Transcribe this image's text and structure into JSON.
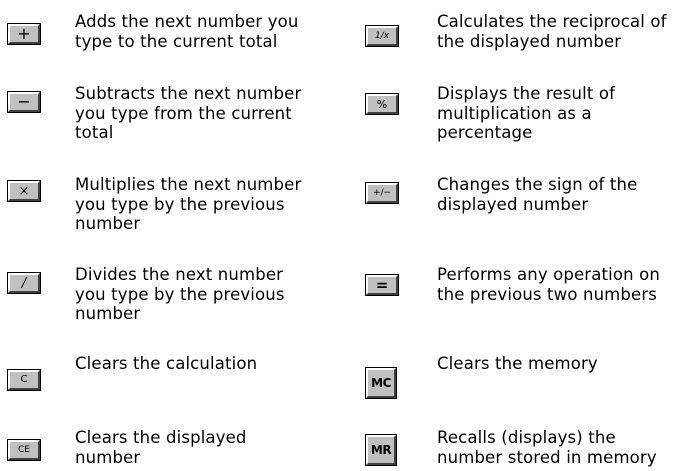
{
  "entries": [
    {
      "key": "+",
      "description_lines": [
        "Adds the next number you",
        "type to the current total"
      ]
    },
    {
      "key": "−",
      "description_lines": [
        "Subtracts the next number",
        "you type from the current",
        "total"
      ]
    },
    {
      "key": "×",
      "description_lines": [
        "Multiplies the next number",
        "you type by the previous",
        "number"
      ]
    },
    {
      "key": "/",
      "description_lines": [
        "Divides the next number",
        "you type by the previous",
        "number"
      ]
    },
    {
      "key": "C",
      "description_lines": [
        "Clears the calculation"
      ]
    },
    {
      "key": "CE",
      "description_lines": [
        "Clears the displayed",
        "number"
      ]
    },
    {
      "key": "1/x",
      "description_lines": [
        "Calculates the reciprocal of",
        "the displayed number"
      ]
    },
    {
      "key": "%",
      "description_lines": [
        "Displays the result of",
        "multiplication as a",
        "percentage"
      ]
    },
    {
      "key": "+/−",
      "description_lines": [
        "Changes the sign of the",
        "displayed number"
      ]
    },
    {
      "key": "=",
      "description_lines": [
        "Performs any operation on",
        "the previous two numbers"
      ]
    },
    {
      "key": "MC",
      "description_lines": [
        "Clears the memory"
      ]
    },
    {
      "key": "MR",
      "description_lines": [
        "Recalls (displays) the",
        "number stored in memory"
      ]
    }
  ]
}
